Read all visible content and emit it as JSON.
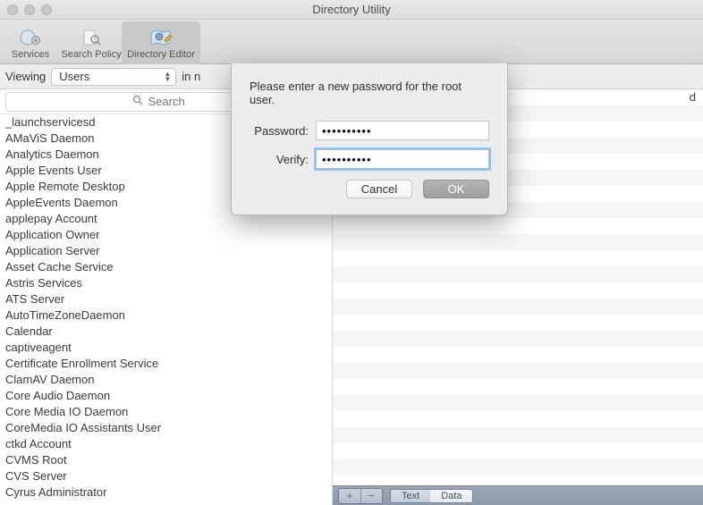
{
  "window": {
    "title": "Directory Utility"
  },
  "toolbar": {
    "items": [
      {
        "name": "services",
        "label": "Services"
      },
      {
        "name": "search-policy",
        "label": "Search Policy"
      },
      {
        "name": "directory-editor",
        "label": "Directory Editor",
        "selected": true
      }
    ]
  },
  "view_row": {
    "viewing_label": "Viewing",
    "viewing_value": "Users",
    "in_node_label": "in n",
    "truncated_right": "d"
  },
  "search": {
    "placeholder": "Search"
  },
  "users": [
    "_launchservicesd",
    "AMaViS Daemon",
    "Analytics Daemon",
    "Apple Events User",
    "Apple Remote Desktop",
    "AppleEvents Daemon",
    "applepay Account",
    "Application Owner",
    "Application Server",
    "Asset Cache Service",
    "Astris Services",
    "ATS Server",
    "AutoTimeZoneDaemon",
    "Calendar",
    "captiveagent",
    "Certificate Enrollment Service",
    "ClamAV Daemon",
    "Core Audio Daemon",
    "Core Media IO Daemon",
    "CoreMedia IO Assistants User",
    "ctkd Account",
    "CVMS Root",
    "CVS Server",
    "Cyrus Administrator"
  ],
  "detail": {
    "footer": {
      "plus": "+",
      "minus": "−",
      "seg_text": "Text",
      "seg_data": "Data"
    }
  },
  "sheet": {
    "prompt": "Please enter a new password for the root user.",
    "password_label": "Password:",
    "verify_label": "Verify:",
    "password_value": "••••••••••",
    "verify_value": "••••••••••",
    "cancel": "Cancel",
    "ok": "OK"
  }
}
